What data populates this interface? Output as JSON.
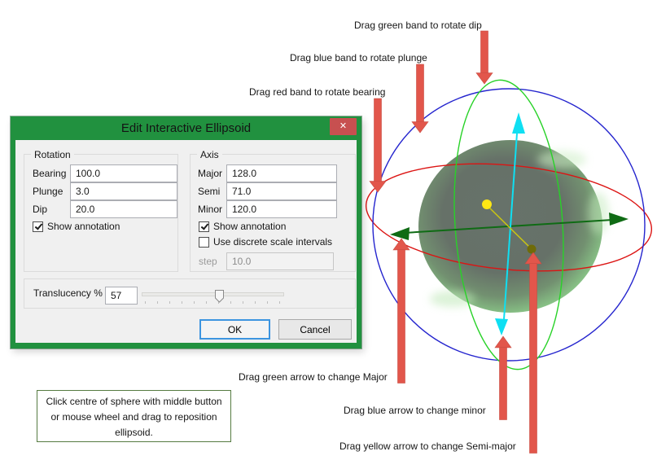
{
  "annotations": {
    "dip_label": "Drag green band to rotate dip",
    "plunge_label": "Drag blue band to rotate plunge",
    "bearing_label": "Drag red band to rotate bearing",
    "major_label": "Drag green arrow to change Major",
    "minor_label": "Drag blue arrow to change minor",
    "semi_major_label": "Drag yellow arrow to change Semi-major",
    "note_text": "Click centre of sphere with middle button or mouse wheel and drag to reposition ellipsoid."
  },
  "dialog": {
    "title": "Edit Interactive Ellipsoid",
    "close_glyph": "✕",
    "rotation": {
      "legend": "Rotation",
      "fields": [
        {
          "label": "Bearing",
          "value": "100.0"
        },
        {
          "label": "Plunge",
          "value": "3.0"
        },
        {
          "label": "Dip",
          "value": "20.0"
        }
      ],
      "show_annotation": {
        "label": "Show annotation",
        "checked": true
      }
    },
    "axis": {
      "legend": "Axis",
      "fields": [
        {
          "label": "Major",
          "value": "128.0"
        },
        {
          "label": "Semi",
          "value": "71.0"
        },
        {
          "label": "Minor",
          "value": "120.0"
        }
      ],
      "show_annotation": {
        "label": "Show annotation",
        "checked": true
      },
      "discrete": {
        "label": "Use discrete scale intervals",
        "checked": false
      },
      "step": {
        "label": "step",
        "value": "10.0"
      }
    },
    "translucency": {
      "label": "Translucency %",
      "value": "57"
    },
    "buttons": {
      "ok": "OK",
      "cancel": "Cancel"
    }
  },
  "colors": {
    "dialog_green": "#21913F",
    "close_red": "#C75050",
    "annotation_arrow_red": "#E2564B",
    "band_red": "#DC1413",
    "band_blue": "#2424CE",
    "band_green": "#28D228",
    "arrow_cyan": "#0FDFF2",
    "arrow_dark_green": "#0F6B14",
    "handle_yellow": "#FFE815",
    "handle_olive": "#6F6B08"
  }
}
